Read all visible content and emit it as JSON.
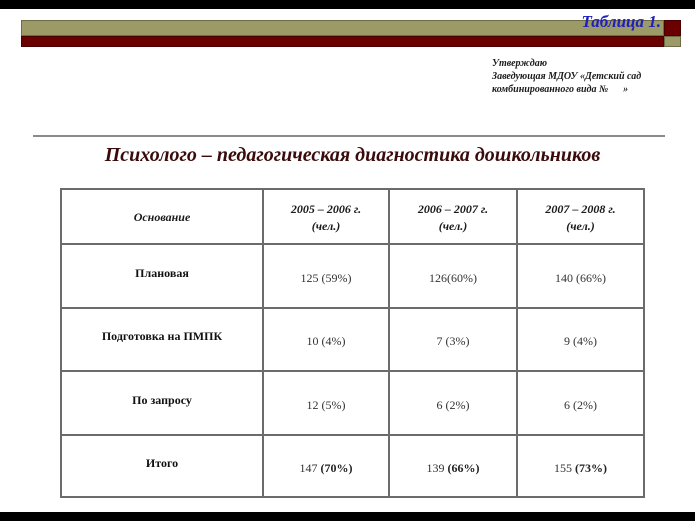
{
  "header": {
    "table_label": "Таблица 1."
  },
  "approval": {
    "lines": [
      "Утверждаю",
      "Заведующая МДОУ «Детский сад",
      "комбинированного вида №      »"
    ]
  },
  "title": "Психолого – педагогическая диагностика дошкольников",
  "table": {
    "columns": [
      {
        "line1": "Основание",
        "line2": ""
      },
      {
        "line1": "2005 – 2006 г.",
        "line2": "(чел.)"
      },
      {
        "line1": "2006 – 2007 г.",
        "line2": "(чел.)"
      },
      {
        "line1": "2007 – 2008 г.",
        "line2": "(чел.)"
      }
    ],
    "rows": [
      {
        "label": "Плановая",
        "cells": [
          "125 (59%)",
          "126(60%)",
          "140 (66%)"
        ]
      },
      {
        "label": "Подготовка на ПМПК",
        "cells": [
          "10 (4%)",
          "7 (3%)",
          "9 (4%)"
        ]
      },
      {
        "label": "По запросу",
        "cells": [
          "12 (5%)",
          "6 (2%)",
          "6 (2%)"
        ]
      }
    ],
    "total": {
      "label": "Итого",
      "cells": [
        {
          "count": "147 ",
          "pct": "(70%)"
        },
        {
          "count": "139 ",
          "pct": "(66%)"
        },
        {
          "count": "155 ",
          "pct": "(73%)"
        }
      ]
    }
  },
  "colors": {
    "bar_olive": "#9c9a67",
    "bar_maroon": "#6a0000",
    "label_blue": "#1f1fbf",
    "title": "#3b0b0b"
  }
}
